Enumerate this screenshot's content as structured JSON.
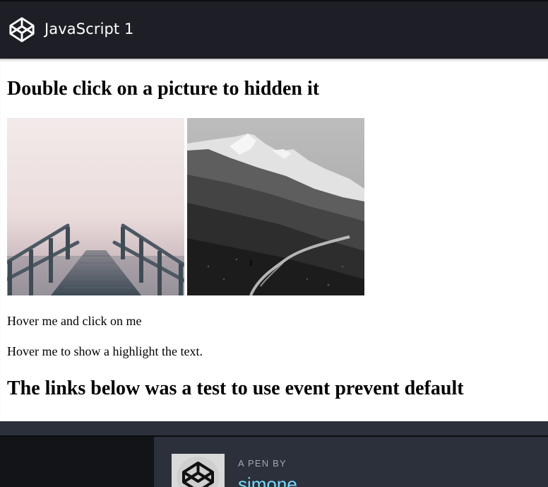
{
  "header": {
    "title": "JavaScript 1",
    "logo_icon": "codepen-logo-icon"
  },
  "content": {
    "heading": "Double click on a picture to hidden it",
    "images": [
      {
        "alt": "foggy wooden stairs",
        "icon": "image"
      },
      {
        "alt": "mountain trail black and white",
        "icon": "image"
      }
    ],
    "hover_click_text": "Hover me and click on me",
    "hover_highlight_text": "Hover me to show a highlight the text.",
    "heading2": "The links below was a test to use event prevent default"
  },
  "footer": {
    "pen_by_label": "A PEN BY",
    "author": "simone",
    "avatar_icon": "codepen-avatar-icon"
  },
  "colors": {
    "header_bg": "#1e1f26",
    "footer_bg": "#2c303a",
    "footer_left_bg": "#131417",
    "author_link": "#76daff",
    "label_gray": "#a4a8b3"
  }
}
